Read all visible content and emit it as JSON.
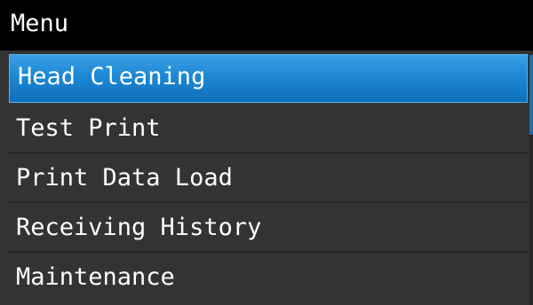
{
  "header": {
    "title": "Menu"
  },
  "menu": {
    "items": [
      {
        "label": "Head Cleaning",
        "selected": true
      },
      {
        "label": "Test Print",
        "selected": false
      },
      {
        "label": "Print Data Load",
        "selected": false
      },
      {
        "label": "Receiving History",
        "selected": false
      },
      {
        "label": "Maintenance",
        "selected": false
      }
    ]
  },
  "colors": {
    "title_bar": "#000000",
    "background": "#333333",
    "selection": "#1e88d4",
    "text": "#ffffff"
  }
}
